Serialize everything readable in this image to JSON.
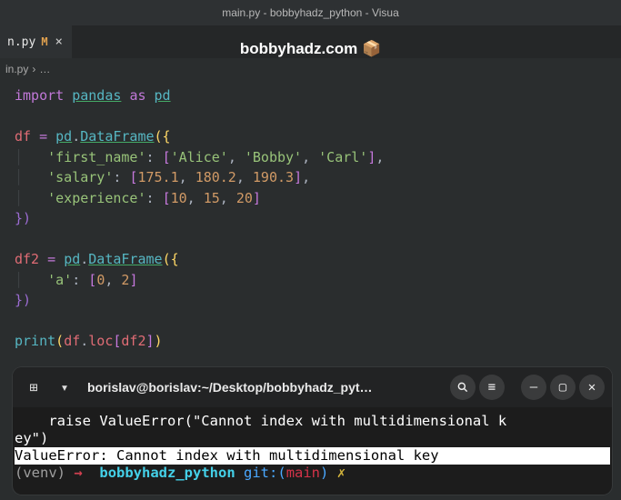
{
  "window_title": "main.py - bobbyhadz_python - Visua",
  "overlay": "bobbyhadz.com 📦",
  "tab": {
    "name": "n.py",
    "modified_marker": "M",
    "close": "×"
  },
  "breadcrumb": {
    "file": "in.py",
    "sep": "›",
    "more": "…"
  },
  "code": {
    "l1": {
      "kw1": "import",
      "mod": "pandas",
      "kw2": "as",
      "alias": "pd"
    },
    "l3": {
      "v": "df",
      "eq": "=",
      "mod": "pd",
      "class": "DataFrame",
      "open": "({"
    },
    "l4": {
      "k": "'first_name'",
      "vals": [
        "'Alice'",
        "'Bobby'",
        "'Carl'"
      ]
    },
    "l5": {
      "k": "'salary'",
      "vals": [
        "175.1",
        "180.2",
        "190.3"
      ]
    },
    "l6": {
      "k": "'experience'",
      "vals": [
        "10",
        "15",
        "20"
      ]
    },
    "l7": {
      "close": "})"
    },
    "l9": {
      "v": "df2",
      "eq": "=",
      "mod": "pd",
      "class": "DataFrame",
      "open": "({"
    },
    "l10": {
      "k": "'a'",
      "vals": [
        "0",
        "2"
      ]
    },
    "l11": {
      "close": "})"
    },
    "l13": {
      "fn": "print",
      "obj": "df",
      "loc": "loc",
      "arg": "df2"
    }
  },
  "terminal": {
    "title": "borislav@borislav:~/Desktop/bobbyhadz_pyt…",
    "buttons": {
      "new_tab": "⊞",
      "dropdown": "▾",
      "search": "🔍",
      "menu": "≡",
      "min": "—",
      "max": "▢",
      "close": "✕"
    },
    "out1": "    raise ValueError(\"Cannot index with multidimensional k",
    "out2": "ey\")",
    "err": "ValueError: Cannot index with multidimensional key",
    "prompt": {
      "venv": "(venv)",
      "arrow": "→",
      "cwd": "bobbyhadz_python",
      "git": "git:(",
      "branch": "main",
      "close": ")",
      "x": "✗"
    }
  }
}
